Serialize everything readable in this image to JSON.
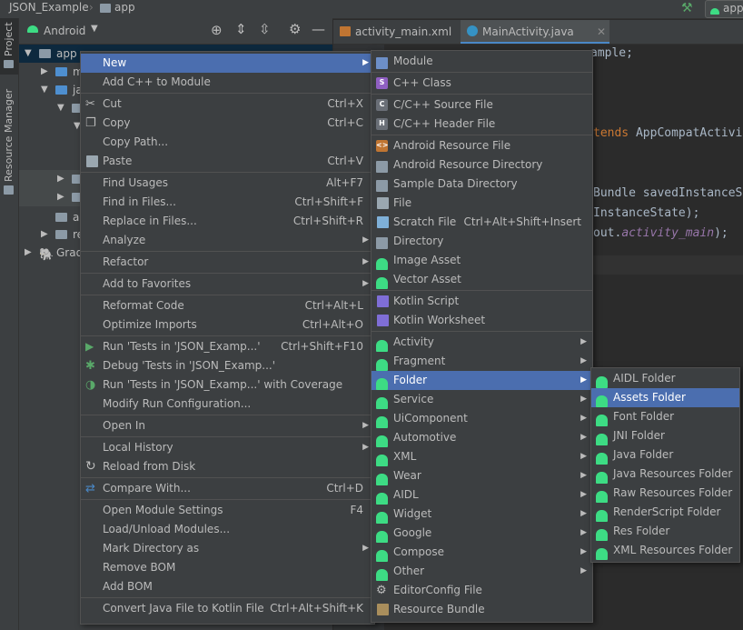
{
  "breadcrumb": {
    "project": "JSON_Example",
    "module": "app"
  },
  "top_right": {
    "run_label": "app"
  },
  "left_tabs": [
    "Project",
    "Resource Manager"
  ],
  "project_header": {
    "view": "Android"
  },
  "tree": [
    {
      "label": "app"
    },
    {
      "label": "m"
    },
    {
      "label": "ja"
    },
    {
      "label": "a"
    },
    {
      "label": "re"
    },
    {
      "label": "Grad"
    }
  ],
  "editor_tabs": [
    {
      "label": "activity_main.xml"
    },
    {
      "label": "MainActivity.java"
    }
  ],
  "code": {
    "l1": "ample;",
    "l2a": "tends ",
    "l2b": "AppCompatActivi",
    "l3": "Bundle savedInstanceS",
    "l4": "InstanceState);",
    "l5a": "out.",
    "l5b": "activity_main",
    "l5c": ");"
  },
  "context_menu": [
    {
      "label": "New",
      "arrow": true,
      "selected": true
    },
    {
      "label": "Add C++ to Module"
    },
    {
      "sep": true
    },
    {
      "label": "Cut",
      "shortcut": "Ctrl+X",
      "icon": "scissors-icon"
    },
    {
      "label": "Copy",
      "shortcut": "Ctrl+C",
      "icon": "copy-icon"
    },
    {
      "label": "Copy Path..."
    },
    {
      "label": "Paste",
      "shortcut": "Ctrl+V",
      "icon": "paste-icon"
    },
    {
      "sep": true
    },
    {
      "label": "Find Usages",
      "shortcut": "Alt+F7"
    },
    {
      "label": "Find in Files...",
      "shortcut": "Ctrl+Shift+F"
    },
    {
      "label": "Replace in Files...",
      "shortcut": "Ctrl+Shift+R"
    },
    {
      "label": "Analyze",
      "arrow": true
    },
    {
      "sep": true
    },
    {
      "label": "Refactor",
      "arrow": true
    },
    {
      "sep": true
    },
    {
      "label": "Add to Favorites",
      "arrow": true
    },
    {
      "sep": true
    },
    {
      "label": "Reformat Code",
      "shortcut": "Ctrl+Alt+L"
    },
    {
      "label": "Optimize Imports",
      "shortcut": "Ctrl+Alt+O"
    },
    {
      "sep": true
    },
    {
      "label": "Run 'Tests in 'JSON_Examp...'",
      "shortcut": "Ctrl+Shift+F10",
      "icon": "run-icon"
    },
    {
      "label": "Debug 'Tests in 'JSON_Examp...'",
      "icon": "debug-icon"
    },
    {
      "label": "Run 'Tests in 'JSON_Examp...' with Coverage",
      "icon": "coverage-icon"
    },
    {
      "label": "Modify Run Configuration..."
    },
    {
      "sep": true
    },
    {
      "label": "Open In",
      "arrow": true
    },
    {
      "sep": true
    },
    {
      "label": "Local History",
      "arrow": true
    },
    {
      "label": "Reload from Disk",
      "icon": "reload-icon"
    },
    {
      "sep": true
    },
    {
      "label": "Compare With...",
      "shortcut": "Ctrl+D",
      "icon": "compare-icon"
    },
    {
      "sep": true
    },
    {
      "label": "Open Module Settings",
      "shortcut": "F4"
    },
    {
      "label": "Load/Unload Modules..."
    },
    {
      "label": "Mark Directory as",
      "arrow": true
    },
    {
      "label": "Remove BOM"
    },
    {
      "label": "Add BOM"
    },
    {
      "sep": true
    },
    {
      "label": "Convert Java File to Kotlin File",
      "shortcut": "Ctrl+Alt+Shift+K"
    }
  ],
  "new_menu": [
    {
      "label": "Module",
      "icon": "module-icon"
    },
    {
      "sep": true
    },
    {
      "label": "C++ Class",
      "icon": "cpp-class-icon"
    },
    {
      "sep": true
    },
    {
      "label": "C/C++ Source File",
      "icon": "cpp-source-icon"
    },
    {
      "label": "C/C++ Header File",
      "icon": "cpp-header-icon"
    },
    {
      "sep": true
    },
    {
      "label": "Android Resource File",
      "icon": "resource-file-icon"
    },
    {
      "label": "Android Resource Directory",
      "icon": "folder-icon"
    },
    {
      "label": "Sample Data Directory",
      "icon": "folder-icon"
    },
    {
      "label": "File",
      "icon": "file-icon"
    },
    {
      "label": "Scratch File",
      "shortcut": "Ctrl+Alt+Shift+Insert",
      "icon": "scratch-file-icon"
    },
    {
      "label": "Directory",
      "icon": "folder-icon"
    },
    {
      "label": "Image Asset",
      "icon": "android-icon"
    },
    {
      "label": "Vector Asset",
      "icon": "android-icon"
    },
    {
      "sep": true
    },
    {
      "label": "Kotlin Script",
      "icon": "kotlin-icon"
    },
    {
      "label": "Kotlin Worksheet",
      "icon": "kotlin-icon"
    },
    {
      "sep": true
    },
    {
      "label": "Activity",
      "arrow": true,
      "icon": "android-icon"
    },
    {
      "label": "Fragment",
      "arrow": true,
      "icon": "android-icon"
    },
    {
      "label": "Folder",
      "arrow": true,
      "icon": "android-icon",
      "selected": true
    },
    {
      "label": "Service",
      "arrow": true,
      "icon": "android-icon"
    },
    {
      "label": "UiComponent",
      "arrow": true,
      "icon": "android-icon"
    },
    {
      "label": "Automotive",
      "arrow": true,
      "icon": "android-icon"
    },
    {
      "label": "XML",
      "arrow": true,
      "icon": "android-icon"
    },
    {
      "label": "Wear",
      "arrow": true,
      "icon": "android-icon"
    },
    {
      "label": "AIDL",
      "arrow": true,
      "icon": "android-icon"
    },
    {
      "label": "Widget",
      "arrow": true,
      "icon": "android-icon"
    },
    {
      "label": "Google",
      "arrow": true,
      "icon": "android-icon"
    },
    {
      "label": "Compose",
      "arrow": true,
      "icon": "android-icon"
    },
    {
      "label": "Other",
      "arrow": true,
      "icon": "android-icon"
    },
    {
      "label": "EditorConfig File",
      "icon": "gear-icon"
    },
    {
      "label": "Resource Bundle",
      "icon": "resource-bundle-icon"
    }
  ],
  "folder_menu": [
    {
      "label": "AIDL Folder"
    },
    {
      "label": "Assets Folder",
      "selected": true
    },
    {
      "label": "Font Folder"
    },
    {
      "label": "JNI Folder"
    },
    {
      "label": "Java Folder"
    },
    {
      "label": "Java Resources Folder"
    },
    {
      "label": "Raw Resources Folder"
    },
    {
      "label": "RenderScript Folder"
    },
    {
      "label": "Res Folder"
    },
    {
      "label": "XML Resources Folder"
    }
  ],
  "colors": {
    "selection": "#4b6eaf",
    "android_green": "#3ddc84",
    "menu_bg": "#3c3f41",
    "editor_bg": "#2b2b2b"
  }
}
